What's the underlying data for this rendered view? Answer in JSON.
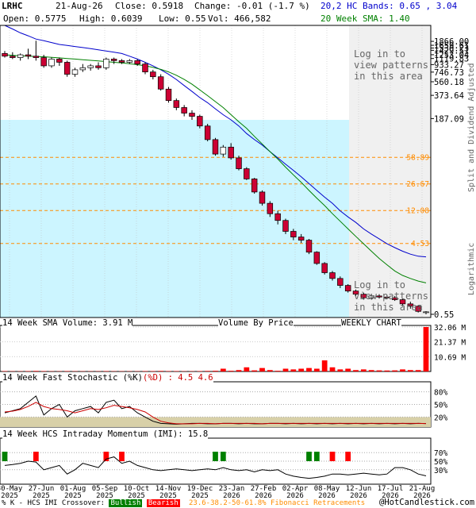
{
  "header": {
    "symbol": "LRHC",
    "date": "21-Aug-26",
    "close_label": "Close: 0.5918",
    "change_label": "Change: -0.01 (-1.7 %)",
    "open_label": "Open: 0.5775",
    "high_label": "High: 0.6039",
    "low_label": "Low: 0.55",
    "vol_label": "Vol: 466,582",
    "bands_label": "20,2 HC Bands: 0.65 , 3.04",
    "sma_label": "20 Week SMA: 1.40"
  },
  "overlay": {
    "login_top": [
      "Log in to",
      "view patterns",
      "in this area"
    ],
    "login_bottom": [
      "Log in to",
      "view patterns",
      "in this area"
    ]
  },
  "side_labels": {
    "split": "Split and Dividend Adjusted",
    "log": "Logarithmic"
  },
  "panels": {
    "volume_title": "14 Week SMA Volume: 3.91 M",
    "volume_by_price": "Volume By Price",
    "weekly_chart": "WEEKLY CHART",
    "stoch_title_a": "14 Week Fast Stochastic (%K)",
    "stoch_title_b": "(%D) : 4.5",
    "stoch_title_c": "4.6",
    "imi_title": "14 Week HCS Intraday Momentum (IMI): 15.8"
  },
  "footer": {
    "legend_prefix": "% K - HCS IMI Crossover:",
    "bullish": "Bullish",
    "bearish": "Bearish",
    "fib": "23.6-38.2-50-61.8% Fibonacci Retracements",
    "copyright": "@HotCandlestick.com"
  },
  "colors": {
    "up": "#ffffff",
    "down": "#cc0033",
    "upper_band": "#0000cc",
    "sma": "#008000",
    "fib": "#ff8c00",
    "highlight": "#ccf5ff",
    "patterns": "#f0f0f0",
    "volume": "#ff0000",
    "stoch_fill": "#d8d0a8",
    "bullish": "#008000",
    "bearish": "#ff0000"
  },
  "chart_data": [
    {
      "type": "candlestick",
      "title": "",
      "scale": "log",
      "y_ticks": [
        1866.0,
        1659.61,
        1530.23,
        1429.51,
        1253.04,
        1119.83,
        933.27,
        746.73,
        560.18,
        373.64,
        187.09,
        0.55
      ],
      "fib_levels": [
        58.89,
        26.67,
        12.08,
        4.53
      ],
      "x_labels": [
        "30-May\n2025",
        "27-Jun\n2025",
        "01-Aug\n2025",
        "05-Sep\n2025",
        "10-Oct\n2025",
        "14-Nov\n2025",
        "19-Dec\n2025",
        "23-Jan\n2026",
        "27-Feb\n2026",
        "02-Apr\n2026",
        "08-May\n2026",
        "12-Jun\n2026",
        "17-Jul\n2026",
        "21-Aug\n2026"
      ],
      "candles": [
        [
          1300,
          1400,
          1150,
          1200
        ],
        [
          1200,
          1350,
          1100,
          1150
        ],
        [
          1150,
          1300,
          1050,
          1250
        ],
        [
          1250,
          1500,
          1100,
          1200
        ],
        [
          1200,
          1900,
          1050,
          1150
        ],
        [
          1150,
          1250,
          850,
          900
        ],
        [
          900,
          1150,
          850,
          1100
        ],
        [
          1100,
          1150,
          900,
          1000
        ],
        [
          1000,
          1050,
          650,
          700
        ],
        [
          700,
          850,
          650,
          800
        ],
        [
          800,
          950,
          750,
          850
        ],
        [
          850,
          950,
          780,
          900
        ],
        [
          900,
          1000,
          800,
          850
        ],
        [
          850,
          1150,
          800,
          1100
        ],
        [
          1100,
          1150,
          950,
          1050
        ],
        [
          1050,
          1100,
          950,
          1000
        ],
        [
          1000,
          1100,
          950,
          1050
        ],
        [
          1050,
          1100,
          900,
          950
        ],
        [
          950,
          1000,
          700,
          750
        ],
        [
          750,
          800,
          600,
          650
        ],
        [
          650,
          700,
          430,
          450
        ],
        [
          450,
          480,
          300,
          320
        ],
        [
          320,
          340,
          240,
          260
        ],
        [
          260,
          280,
          200,
          220
        ],
        [
          220,
          240,
          180,
          200
        ],
        [
          200,
          210,
          140,
          150
        ],
        [
          150,
          160,
          95,
          100
        ],
        [
          100,
          105,
          62,
          65
        ],
        [
          65,
          85,
          60,
          80
        ],
        [
          80,
          90,
          55,
          58
        ],
        [
          58,
          62,
          40,
          42
        ],
        [
          42,
          44,
          30,
          31
        ],
        [
          31,
          32,
          20,
          21
        ],
        [
          21,
          22,
          14,
          15
        ],
        [
          15,
          16,
          10,
          11
        ],
        [
          11,
          12,
          8,
          9
        ],
        [
          9,
          9.5,
          6,
          6.5
        ],
        [
          6.5,
          7,
          5,
          5.5
        ],
        [
          5.5,
          6,
          4.6,
          5
        ],
        [
          5,
          5.2,
          3.3,
          3.5
        ],
        [
          3.5,
          3.6,
          2.4,
          2.5
        ],
        [
          2.5,
          2.6,
          1.8,
          1.9
        ],
        [
          1.9,
          2,
          1.5,
          1.6
        ],
        [
          1.6,
          1.7,
          1.2,
          1.3
        ],
        [
          1.3,
          1.35,
          1.05,
          1.1
        ],
        [
          1.1,
          1.15,
          0.95,
          1.0
        ],
        [
          1.0,
          1.05,
          0.85,
          0.9
        ],
        [
          0.9,
          1.0,
          0.85,
          0.95
        ],
        [
          0.95,
          1.0,
          0.88,
          0.92
        ],
        [
          0.92,
          0.98,
          0.86,
          0.9
        ],
        [
          0.9,
          0.95,
          0.82,
          0.85
        ],
        [
          0.85,
          0.88,
          0.7,
          0.75
        ],
        [
          0.75,
          0.8,
          0.65,
          0.7
        ],
        [
          0.7,
          0.72,
          0.58,
          0.6
        ],
        [
          0.5775,
          0.6039,
          0.55,
          0.5918
        ]
      ],
      "upper_band": [
        3000,
        2700,
        2400,
        2200,
        2000,
        1900,
        1800,
        1700,
        1650,
        1600,
        1550,
        1500,
        1450,
        1400,
        1350,
        1300,
        1200,
        1100,
        1000,
        900,
        800,
        700,
        600,
        500,
        420,
        350,
        300,
        250,
        210,
        180,
        150,
        120,
        100,
        85,
        70,
        58,
        48,
        40,
        33,
        27,
        22,
        18,
        15,
        12,
        10,
        8.5,
        7,
        6,
        5.2,
        4.5,
        4,
        3.6,
        3.3,
        3.1,
        3.04
      ],
      "sma": [
        1250,
        1230,
        1210,
        1200,
        1190,
        1180,
        1160,
        1140,
        1120,
        1100,
        1080,
        1060,
        1040,
        1020,
        1000,
        980,
        960,
        930,
        900,
        860,
        810,
        750,
        680,
        600,
        520,
        440,
        370,
        310,
        260,
        210,
        170,
        140,
        110,
        88,
        70,
        56,
        44,
        35,
        28,
        22,
        17.5,
        14,
        11,
        8.8,
        7,
        5.6,
        4.5,
        3.6,
        2.9,
        2.4,
        2.0,
        1.75,
        1.6,
        1.48,
        1.4
      ]
    },
    {
      "type": "bar",
      "title": "14 Week SMA Volume: 3.91 M",
      "y_ticks": [
        "32.06 M",
        "21.37 M",
        "10.69 M"
      ],
      "values": [
        0.3,
        0.2,
        0.2,
        0.3,
        0.4,
        0.3,
        0.2,
        0.2,
        0.3,
        0.2,
        0.2,
        0.2,
        0.2,
        0.3,
        0.2,
        0.2,
        0.2,
        0.2,
        0.3,
        0.3,
        0.4,
        0.3,
        0.3,
        0.2,
        0.2,
        0.3,
        0.4,
        0.5,
        2.0,
        0.5,
        1.0,
        3.0,
        0.8,
        2.5,
        1.0,
        0.5,
        2.0,
        1.5,
        2.0,
        2.5,
        2.0,
        8.0,
        3.0,
        1.5,
        2.0,
        1.0,
        1.5,
        1.0,
        0.8,
        0.7,
        0.8,
        1.5,
        1.0,
        1.0,
        32.06
      ]
    },
    {
      "type": "line",
      "title": "14 Week Fast Stochastic",
      "y_ticks": [
        "80%",
        "50%",
        "20%"
      ],
      "k": [
        30,
        35,
        40,
        55,
        70,
        25,
        40,
        50,
        20,
        35,
        40,
        45,
        30,
        55,
        60,
        40,
        45,
        30,
        20,
        10,
        5,
        4,
        3,
        4,
        5,
        5,
        4,
        4,
        5,
        5,
        4,
        5,
        4,
        4,
        5,
        5,
        4,
        5,
        4,
        5,
        4,
        5,
        4,
        5,
        4,
        5,
        4,
        5,
        4,
        5,
        4,
        5,
        4,
        5,
        4.5
      ],
      "d": [
        32,
        34,
        38,
        45,
        55,
        45,
        40,
        38,
        35,
        30,
        35,
        40,
        38,
        42,
        48,
        45,
        42,
        38,
        32,
        20,
        10,
        6,
        4,
        4,
        4,
        5,
        5,
        4,
        5,
        5,
        5,
        5,
        5,
        4,
        5,
        5,
        5,
        5,
        5,
        5,
        5,
        5,
        5,
        5,
        5,
        5,
        5,
        5,
        5,
        5,
        5,
        5,
        5,
        5,
        4.6
      ]
    },
    {
      "type": "line",
      "title": "14 Week HCS Intraday Momentum (IMI): 15.8",
      "y_ticks": [
        "70%",
        "50%",
        "30%"
      ],
      "imi": [
        40,
        42,
        45,
        50,
        48,
        30,
        35,
        40,
        20,
        30,
        45,
        40,
        35,
        55,
        60,
        45,
        50,
        40,
        35,
        30,
        28,
        30,
        32,
        30,
        28,
        30,
        32,
        30,
        35,
        30,
        28,
        30,
        25,
        30,
        28,
        30,
        20,
        15,
        12,
        10,
        12,
        15,
        20,
        20,
        18,
        20,
        22,
        20,
        18,
        20,
        35,
        35,
        30,
        20,
        15.8
      ],
      "bullish_weeks": [
        0,
        27,
        28,
        39,
        40
      ],
      "bearish_weeks": [
        4,
        13,
        15,
        42,
        44
      ]
    }
  ]
}
